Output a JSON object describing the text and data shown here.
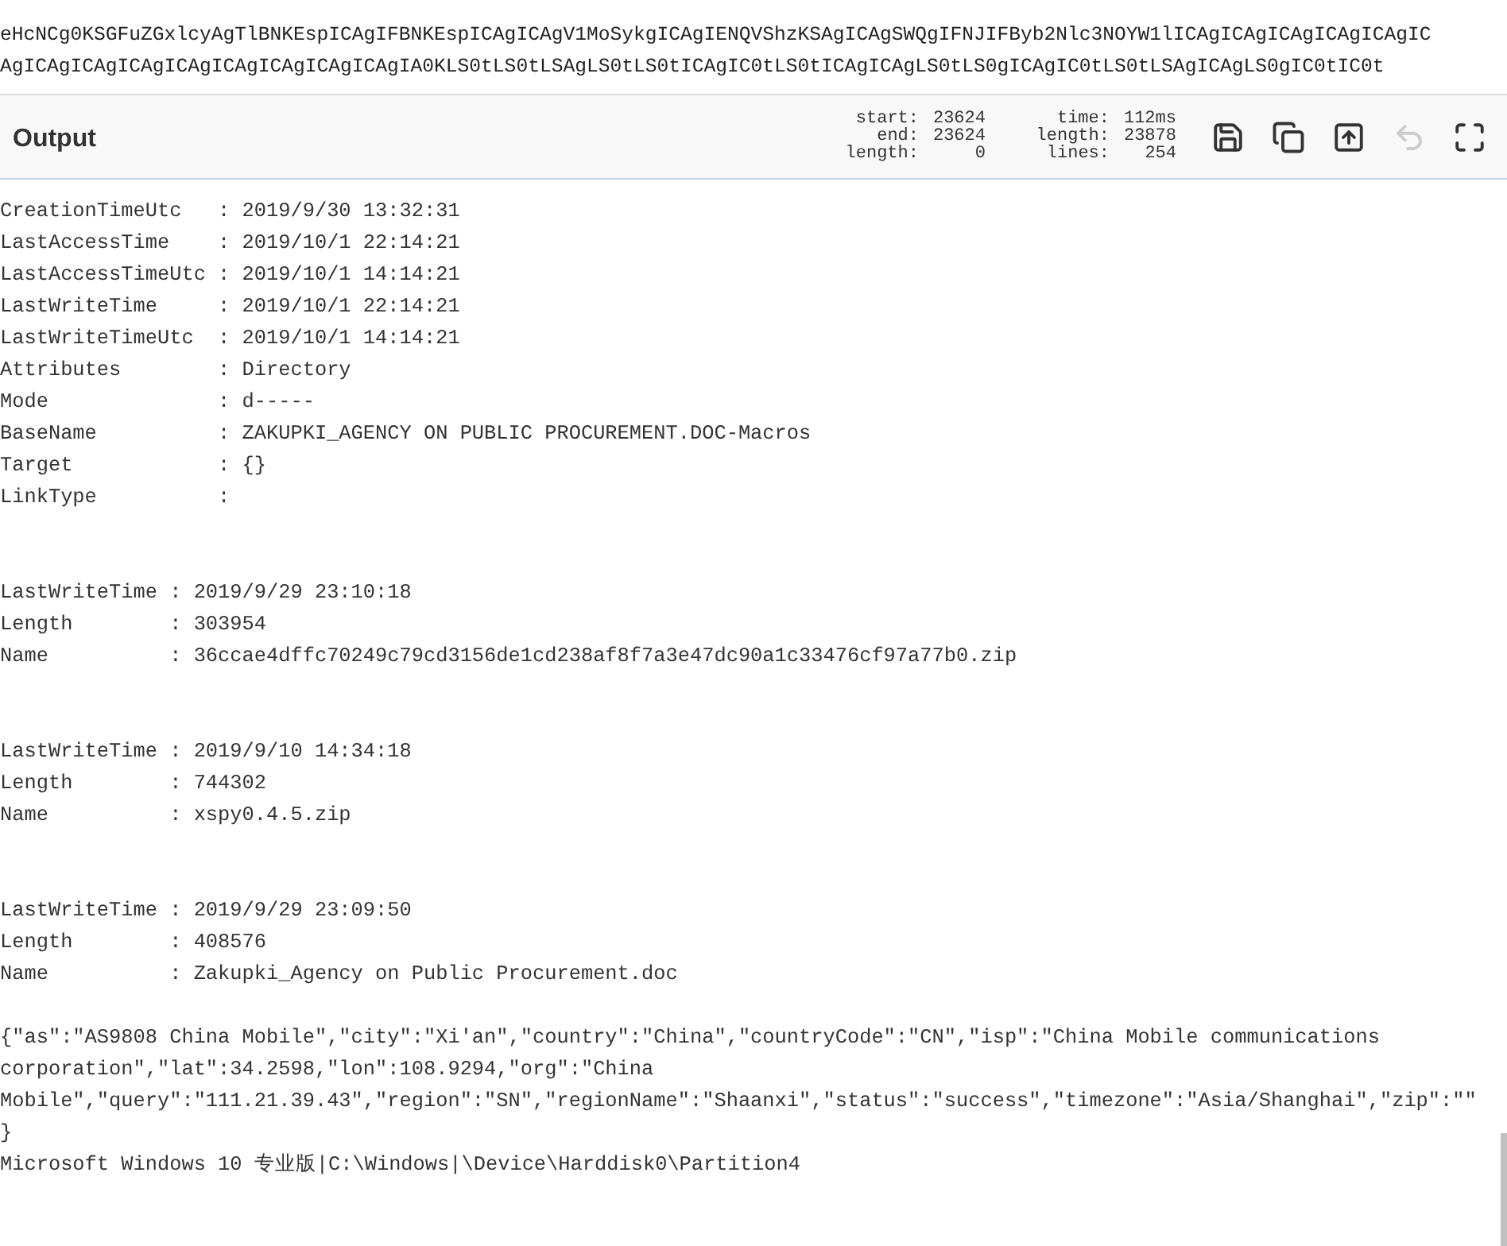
{
  "input_lines": [
    "eHcNCg0KSGFuZGxlcyAgTlBNKEspICAgIFBNKEspICAgICAgV1MoSykgICAgIENQVShzKSAgICAgSWQgIFNJIFByb2Nlc3NOYW1lICAgICAgICAgICAgICAgIC",
    "AgICAgICAgICAgICAgICAgICAgICAgICAgIA0KLS0tLS0tLSAgLS0tLS0tICAgIC0tLS0tICAgICAgLS0tLS0gICAgIC0tLS0tLSAgICAgLS0gIC0tIC0t"
  ],
  "output": {
    "title": "Output",
    "stats": [
      {
        "label": "start:",
        "value": "23624"
      },
      {
        "label": "end:",
        "value": "23624"
      },
      {
        "label": "length:",
        "value": "0"
      },
      {
        "label": "time:",
        "value": "112ms"
      },
      {
        "label": "length:",
        "value": "23878"
      },
      {
        "label": "lines:",
        "value": "254"
      }
    ],
    "tools": [
      {
        "kind": "save",
        "disabled": false
      },
      {
        "kind": "copy",
        "disabled": false
      },
      {
        "kind": "replace",
        "disabled": false
      },
      {
        "kind": "undo",
        "disabled": true
      },
      {
        "kind": "maximise",
        "disabled": false
      }
    ],
    "groups": [
      {
        "lines": [
          "CreationTimeUtc   : 2019/9/30 13:32:31",
          "LastAccessTime    : 2019/10/1 22:14:21",
          "LastAccessTimeUtc : 2019/10/1 14:14:21",
          "LastWriteTime     : 2019/10/1 22:14:21",
          "LastWriteTimeUtc  : 2019/10/1 14:14:21",
          "Attributes        : Directory",
          "Mode              : d-----",
          "BaseName          : ZAKUPKI_AGENCY ON PUBLIC PROCUREMENT.DOC-Macros",
          "Target            : {}",
          "LinkType          :"
        ]
      },
      {
        "lines": [
          "LastWriteTime : 2019/9/29 23:10:18",
          "Length        : 303954",
          "Name          : 36ccae4dffc70249c79cd3156de1cd238af8f7a3e47dc90a1c33476cf97a77b0.zip"
        ]
      },
      {
        "lines": [
          "LastWriteTime : 2019/9/10 14:34:18",
          "Length        : 744302",
          "Name          : xspy0.4.5.zip"
        ]
      },
      {
        "lines": [
          "LastWriteTime : 2019/9/29 23:09:50",
          "Length        : 408576",
          "Name          : Zakupki_Agency on Public Procurement.doc"
        ]
      }
    ],
    "json_text": "{\"as\":\"AS9808 China Mobile\",\"city\":\"Xi'an\",\"country\":\"China\",\"countryCode\":\"CN\",\"isp\":\"China Mobile communications corporation\",\"lat\":34.2598,\"lon\":108.9294,\"org\":\"China Mobile\",\"query\":\"111.21.39.43\",\"region\":\"SN\",\"regionName\":\"Shaanxi\",\"status\":\"success\",\"timezone\":\"Asia/Shanghai\",\"zip\":\"\"\n}",
    "system_line": "Microsoft Windows 10 专业版|C:\\Windows|\\Device\\Harddisk0\\Partition4"
  }
}
